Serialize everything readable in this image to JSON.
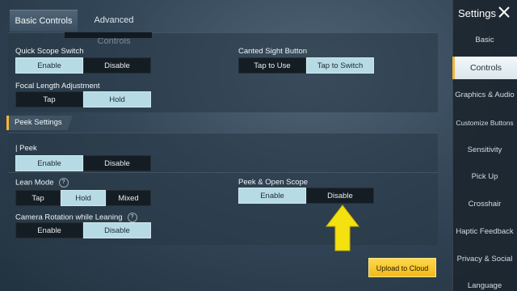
{
  "tabs": [
    {
      "label": "Basic Controls",
      "active": true
    },
    {
      "label": "Advanced Controls",
      "active": false
    }
  ],
  "settings": {
    "quick_scope": {
      "label": "Quick Scope Switch",
      "options": [
        "Enable",
        "Disable"
      ],
      "selected": "Enable"
    },
    "canted_sight": {
      "label": "Canted Sight Button",
      "options": [
        "Tap to Use",
        "Tap to Switch"
      ],
      "selected": "Tap to Switch"
    },
    "focal_length": {
      "label": "Focal Length Adjustment",
      "options": [
        "Tap",
        "Hold"
      ],
      "selected": "Hold"
    }
  },
  "peek_section": {
    "header": "Peek Settings",
    "peek": {
      "label": "| Peek",
      "options": [
        "Enable",
        "Disable"
      ],
      "selected": "Enable"
    },
    "lean_mode": {
      "label": "Lean Mode",
      "help_icon": "?",
      "options": [
        "Tap",
        "Hold",
        "Mixed"
      ],
      "selected": "Hold"
    },
    "peek_open_scope": {
      "label": "Peek & Open Scope",
      "options": [
        "Enable",
        "Disable"
      ],
      "selected": "Enable"
    },
    "camera_rotation": {
      "label": "Camera Rotation while Leaning",
      "help_icon": "?",
      "options": [
        "Enable",
        "Disable"
      ],
      "selected": "Disable"
    }
  },
  "upload_button": "Upload to Cloud",
  "sidebar": {
    "title": "Settings",
    "items": [
      {
        "label": "Basic",
        "active": false
      },
      {
        "label": "Controls",
        "active": true
      },
      {
        "label": "Graphics & Audio",
        "active": false
      },
      {
        "label": "Customize Buttons",
        "active": false
      },
      {
        "label": "Sensitivity",
        "active": false
      },
      {
        "label": "Pick Up",
        "active": false
      },
      {
        "label": "Crosshair",
        "active": false
      },
      {
        "label": "Haptic Feedback",
        "active": false
      },
      {
        "label": "Privacy & Social",
        "active": false
      },
      {
        "label": "Language",
        "active": false
      }
    ]
  },
  "colors": {
    "accent": "#f3b53a",
    "selected": "#b7dbe4",
    "arrow": "#f5e010"
  },
  "icons": {
    "close": "close-icon",
    "help": "help-icon",
    "arrow": "arrow-up-icon"
  }
}
